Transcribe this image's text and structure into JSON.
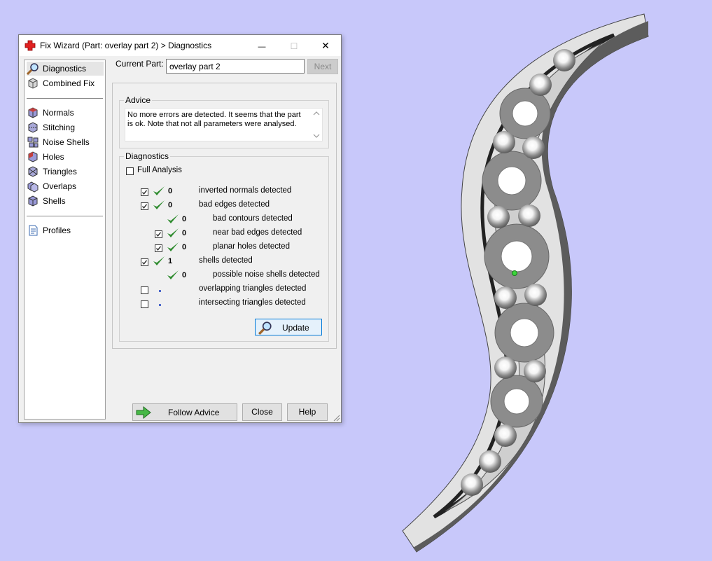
{
  "window": {
    "title": "Fix Wizard (Part: overlay part 2) > Diagnostics",
    "minimize": "—",
    "maximize": "☐",
    "close": "✕"
  },
  "sidebar": {
    "items": [
      {
        "label": "Diagnostics",
        "icon": "magnifier-icon"
      },
      {
        "label": "Combined Fix",
        "icon": "cube-icon"
      },
      {
        "label": "Normals",
        "icon": "normals-icon"
      },
      {
        "label": "Stitching",
        "icon": "stitching-icon"
      },
      {
        "label": "Noise Shells",
        "icon": "noise-shells-icon"
      },
      {
        "label": "Holes",
        "icon": "holes-icon"
      },
      {
        "label": "Triangles",
        "icon": "triangles-icon"
      },
      {
        "label": "Overlaps",
        "icon": "overlaps-icon"
      },
      {
        "label": "Shells",
        "icon": "shells-icon"
      },
      {
        "label": "Profiles",
        "icon": "profiles-icon"
      }
    ]
  },
  "part": {
    "label": "Current Part:",
    "value": "overlay part 2",
    "next_label": "Next"
  },
  "advice": {
    "title": "Advice",
    "text": "No more errors are detected. It seems that the part is ok. Note that not all parameters were analysed."
  },
  "diagnostics": {
    "title": "Diagnostics",
    "full_analysis": "Full Analysis",
    "rows": [
      {
        "count": "0",
        "label": "inverted normals detected",
        "checked": true
      },
      {
        "count": "0",
        "label": "bad edges detected",
        "checked": true
      },
      {
        "count": "0",
        "label": "bad contours detected",
        "checked": null
      },
      {
        "count": "0",
        "label": "near bad edges detected",
        "checked": true
      },
      {
        "count": "0",
        "label": "planar holes detected",
        "checked": true
      },
      {
        "count": "1",
        "label": "shells detected",
        "checked": true
      },
      {
        "count": "0",
        "label": "possible noise shells detected",
        "checked": null
      },
      {
        "count": "",
        "label": "overlapping triangles detected",
        "checked": false
      },
      {
        "count": "",
        "label": "intersecting triangles detected",
        "checked": false
      }
    ],
    "update_label": "Update"
  },
  "footer": {
    "follow_advice": "Follow Advice",
    "close": "Close",
    "help": "Help"
  },
  "colors": {
    "desktop": "#c8c8fa",
    "check_green": "#2e8b2e",
    "part_gray": "#b4b4b4"
  }
}
